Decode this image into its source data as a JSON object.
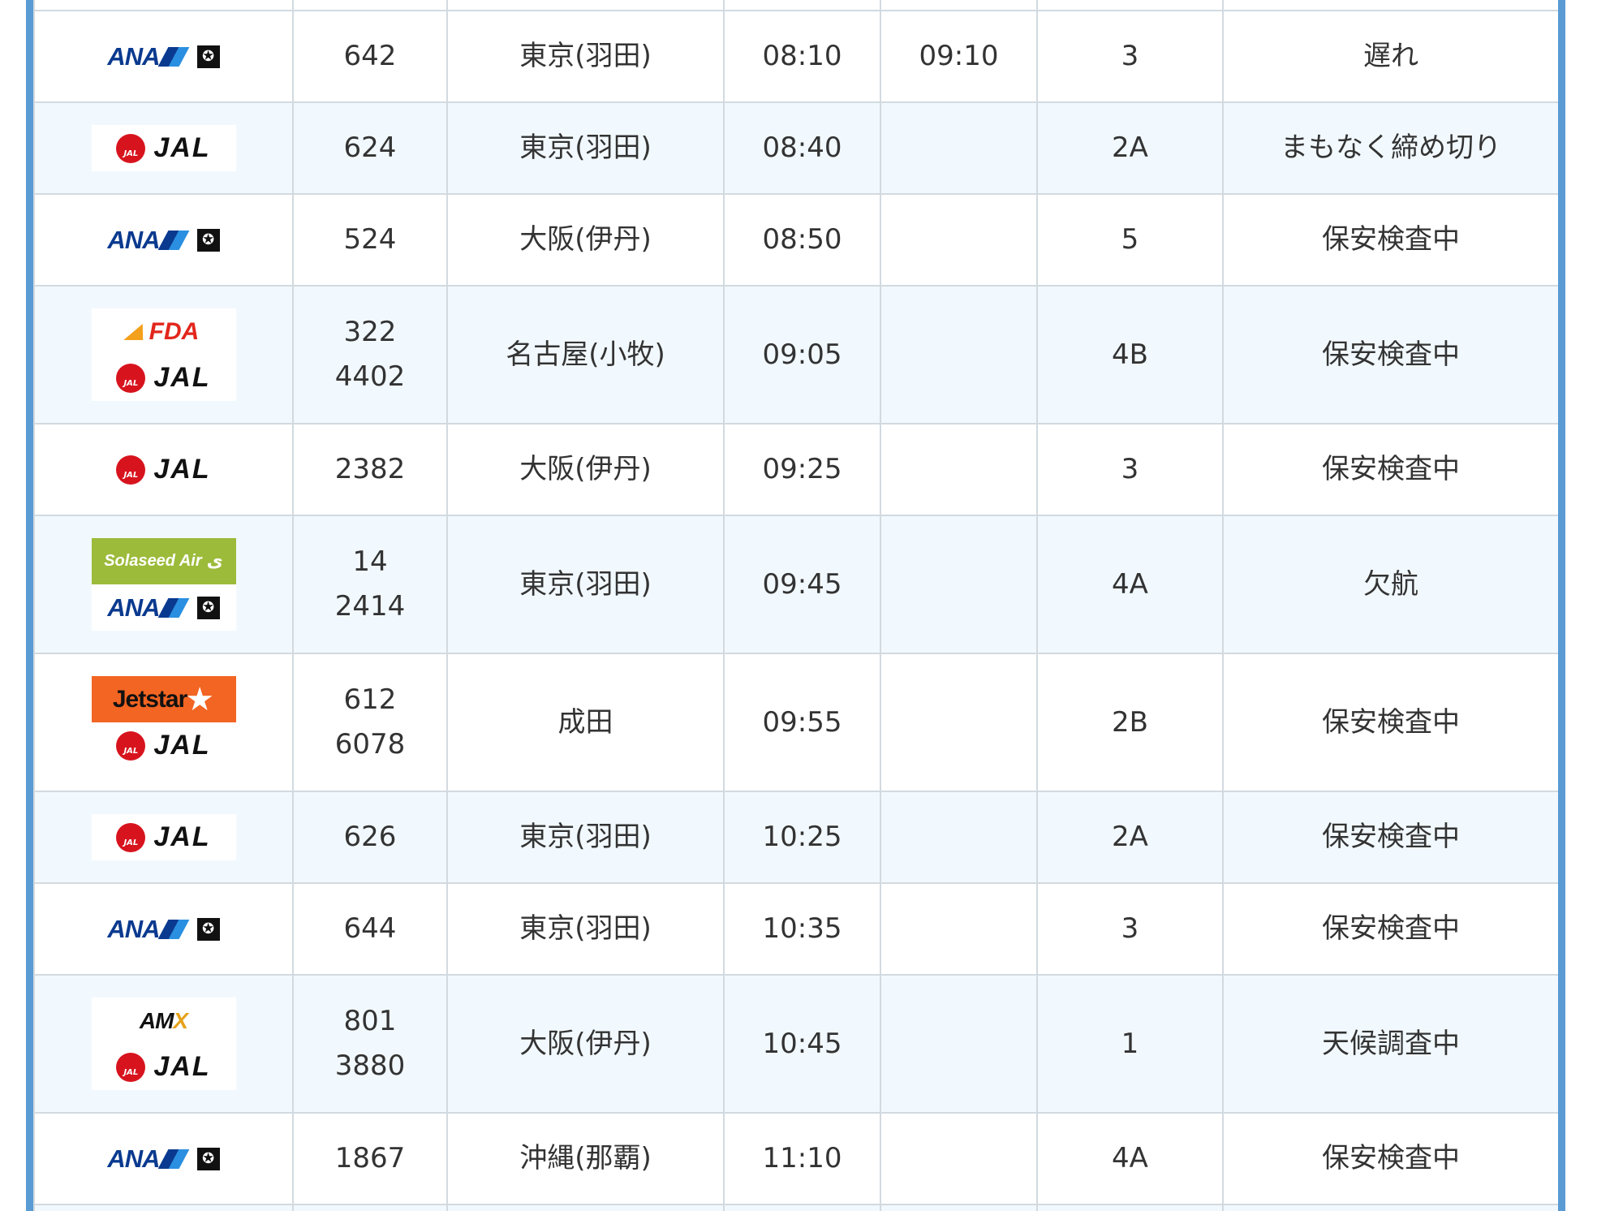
{
  "airlines": {
    "ana": {
      "word": "ANA",
      "star_glyph": "✪"
    },
    "jal": {
      "word": "JAL",
      "crane_text": "JAL"
    },
    "fda": {
      "word": "FDA"
    },
    "solaseed": {
      "word": "Solaseed Air",
      "mark": "ی"
    },
    "jetstar": {
      "word": "Jetstar",
      "star": "★"
    },
    "amx": {
      "word_a": "AM",
      "word_x": "X"
    }
  },
  "flights": [
    {
      "airlines": [
        "ana"
      ],
      "numbers": [
        "642"
      ],
      "destination": "東京(羽田)",
      "scheduled": "08:10",
      "changed": "09:10",
      "gate": "3",
      "status": "遅れ"
    },
    {
      "airlines": [
        "jal"
      ],
      "numbers": [
        "624"
      ],
      "destination": "東京(羽田)",
      "scheduled": "08:40",
      "changed": "",
      "gate": "2A",
      "status": "まもなく締め切り"
    },
    {
      "airlines": [
        "ana"
      ],
      "numbers": [
        "524"
      ],
      "destination": "大阪(伊丹)",
      "scheduled": "08:50",
      "changed": "",
      "gate": "5",
      "status": "保安検査中"
    },
    {
      "airlines": [
        "fda",
        "jal"
      ],
      "numbers": [
        "322",
        "4402"
      ],
      "destination": "名古屋(小牧)",
      "scheduled": "09:05",
      "changed": "",
      "gate": "4B",
      "status": "保安検査中"
    },
    {
      "airlines": [
        "jal"
      ],
      "numbers": [
        "2382"
      ],
      "destination": "大阪(伊丹)",
      "scheduled": "09:25",
      "changed": "",
      "gate": "3",
      "status": "保安検査中"
    },
    {
      "airlines": [
        "solaseed",
        "ana"
      ],
      "numbers": [
        "14",
        "2414"
      ],
      "destination": "東京(羽田)",
      "scheduled": "09:45",
      "changed": "",
      "gate": "4A",
      "status": "欠航"
    },
    {
      "airlines": [
        "jetstar",
        "jal"
      ],
      "numbers": [
        "612",
        "6078"
      ],
      "destination": "成田",
      "scheduled": "09:55",
      "changed": "",
      "gate": "2B",
      "status": "保安検査中"
    },
    {
      "airlines": [
        "jal"
      ],
      "numbers": [
        "626"
      ],
      "destination": "東京(羽田)",
      "scheduled": "10:25",
      "changed": "",
      "gate": "2A",
      "status": "保安検査中"
    },
    {
      "airlines": [
        "ana"
      ],
      "numbers": [
        "644"
      ],
      "destination": "東京(羽田)",
      "scheduled": "10:35",
      "changed": "",
      "gate": "3",
      "status": "保安検査中"
    },
    {
      "airlines": [
        "amx",
        "jal"
      ],
      "numbers": [
        "801",
        "3880"
      ],
      "destination": "大阪(伊丹)",
      "scheduled": "10:45",
      "changed": "",
      "gate": "1",
      "status": "天候調査中"
    },
    {
      "airlines": [
        "ana"
      ],
      "numbers": [
        "1867"
      ],
      "destination": "沖縄(那覇)",
      "scheduled": "11:10",
      "changed": "",
      "gate": "4A",
      "status": "保安検査中"
    }
  ],
  "colors": {
    "frame": "#5a9bd3",
    "row_alt": "#f2f9fe",
    "grid": "#d2dae0"
  }
}
